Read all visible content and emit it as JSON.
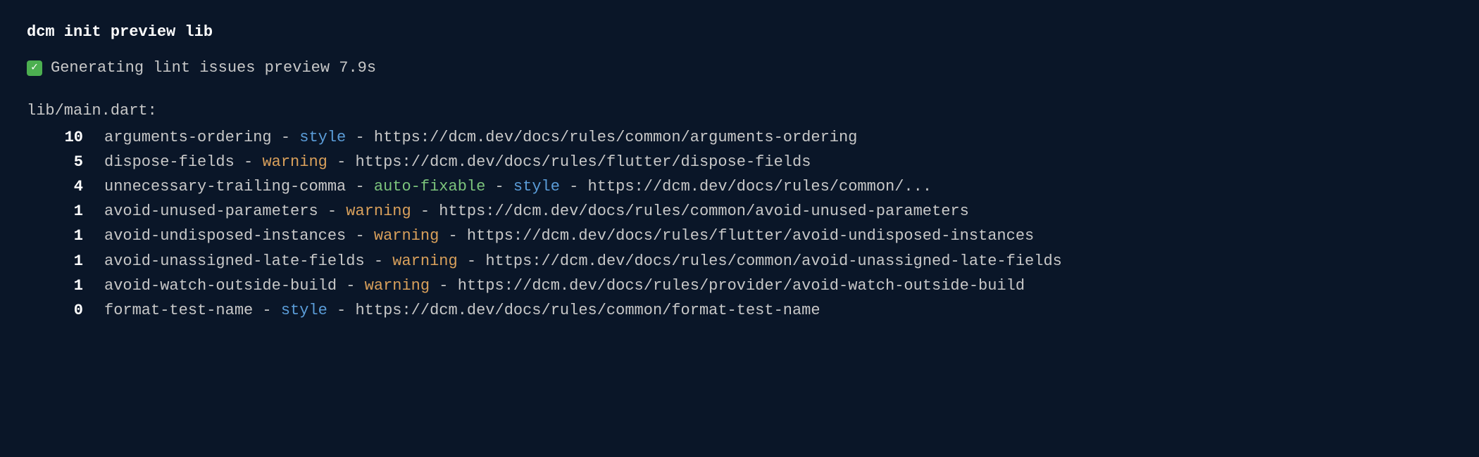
{
  "command": "dcm init preview lib",
  "status": {
    "icon": "✓",
    "text": "Generating lint issues preview 7.9s"
  },
  "file": "lib/main.dart:",
  "separator": " - ",
  "issues": [
    {
      "count": "10",
      "rule": "arguments-ordering",
      "tags": [
        "style"
      ],
      "url": "https://dcm.dev/docs/rules/common/arguments-ordering"
    },
    {
      "count": "5",
      "rule": "dispose-fields",
      "tags": [
        "warning"
      ],
      "url": "https://dcm.dev/docs/rules/flutter/dispose-fields"
    },
    {
      "count": "4",
      "rule": "unnecessary-trailing-comma",
      "tags": [
        "auto-fixable",
        "style"
      ],
      "url": "https://dcm.dev/docs/rules/common/..."
    },
    {
      "count": "1",
      "rule": "avoid-unused-parameters",
      "tags": [
        "warning"
      ],
      "url": "https://dcm.dev/docs/rules/common/avoid-unused-parameters"
    },
    {
      "count": "1",
      "rule": "avoid-undisposed-instances",
      "tags": [
        "warning"
      ],
      "url": "https://dcm.dev/docs/rules/flutter/avoid-undisposed-instances"
    },
    {
      "count": "1",
      "rule": "avoid-unassigned-late-fields",
      "tags": [
        "warning"
      ],
      "url": "https://dcm.dev/docs/rules/common/avoid-unassigned-late-fields"
    },
    {
      "count": "1",
      "rule": "avoid-watch-outside-build",
      "tags": [
        "warning"
      ],
      "url": "https://dcm.dev/docs/rules/provider/avoid-watch-outside-build"
    },
    {
      "count": "0",
      "rule": "format-test-name",
      "tags": [
        "style"
      ],
      "url": "https://dcm.dev/docs/rules/common/format-test-name"
    }
  ]
}
